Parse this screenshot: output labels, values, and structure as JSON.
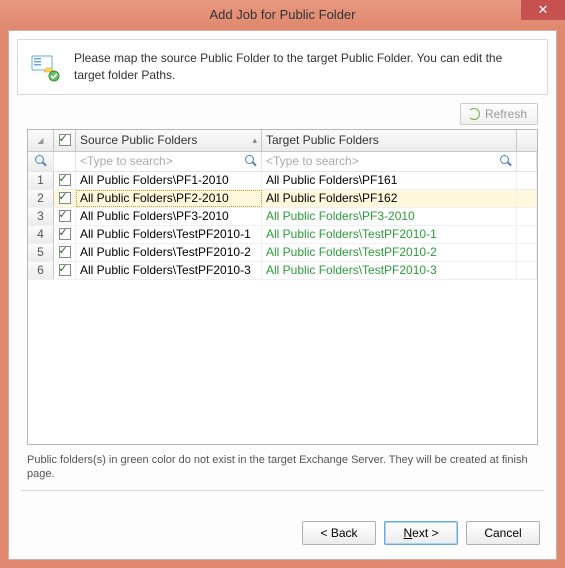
{
  "title": "Add Job for Public Folder",
  "instruction": "Please map the source Public Folder to the target Public Folder. You can edit the target folder Paths.",
  "refresh_label": "Refresh",
  "columns": {
    "source": "Source Public Folders",
    "target": "Target Public Folders"
  },
  "search_placeholder": "<Type to search>",
  "header_checkbox_checked": true,
  "selected_row_index": 2,
  "rows": [
    {
      "idx": "1",
      "checked": true,
      "source": "All Public Folders\\PF1-2010",
      "target": "All Public Folders\\PF161",
      "target_new": false
    },
    {
      "idx": "2",
      "checked": true,
      "source": "All Public Folders\\PF2-2010",
      "target": "All Public Folders\\PF162",
      "target_new": false
    },
    {
      "idx": "3",
      "checked": true,
      "source": "All Public Folders\\PF3-2010",
      "target": "All Public Folders\\PF3-2010",
      "target_new": true
    },
    {
      "idx": "4",
      "checked": true,
      "source": "All Public Folders\\TestPF2010-1",
      "target": "All Public Folders\\TestPF2010-1",
      "target_new": true
    },
    {
      "idx": "5",
      "checked": true,
      "source": "All Public Folders\\TestPF2010-2",
      "target": "All Public Folders\\TestPF2010-2",
      "target_new": true
    },
    {
      "idx": "6",
      "checked": true,
      "source": "All Public Folders\\TestPF2010-3",
      "target": "All Public Folders\\TestPF2010-3",
      "target_new": true
    }
  ],
  "footnote": "Public folders(s) in green color do not exist in the target Exchange Server. They will be created at finish page.",
  "buttons": {
    "back": "< Back",
    "next": "Next >",
    "cancel": "Cancel"
  }
}
